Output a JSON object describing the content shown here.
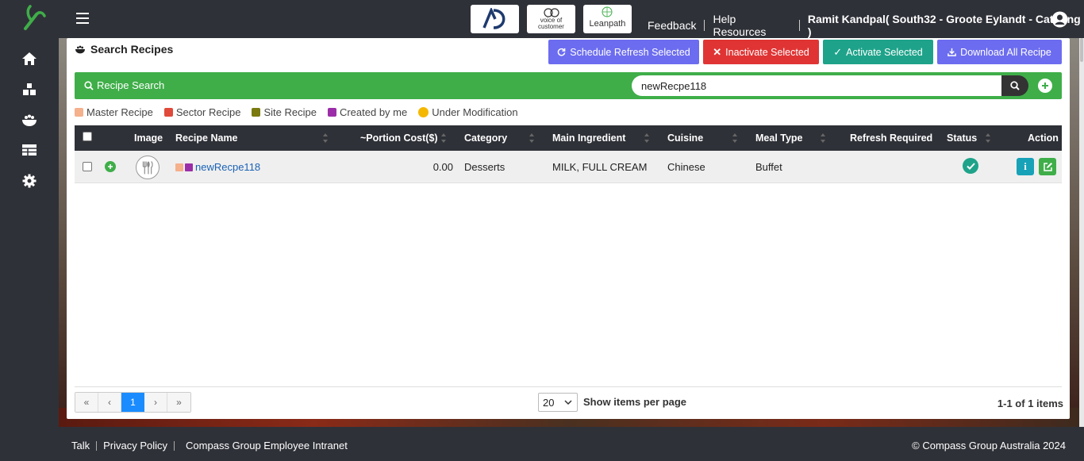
{
  "header": {
    "brands": [
      "AD",
      "voice of customer",
      "Leanpath"
    ],
    "links": [
      "Feedback",
      "Help Resources"
    ],
    "user": "Ramit Kandpal( South32 - Groote Eylandt - Catering )"
  },
  "sidebar": {
    "items": [
      "home-icon",
      "inventory-icon",
      "recipe-icon",
      "table-icon",
      "gear-icon"
    ]
  },
  "page": {
    "title": "Search Recipes",
    "buttons": {
      "refresh": "Schedule Refresh Selected",
      "inactivate": "Inactivate Selected",
      "activate": "Activate Selected",
      "download": "Download All Recipe"
    },
    "search": {
      "label": "Recipe Search",
      "value": "newRecpe118"
    },
    "legend": [
      {
        "label": "Master Recipe",
        "color": "#f5b08c"
      },
      {
        "label": "Sector Recipe",
        "color": "#e04a3a"
      },
      {
        "label": "Site Recipe",
        "color": "#7a7a10"
      },
      {
        "label": "Created by me",
        "color": "#9b2ea8"
      },
      {
        "label": "Under Modification",
        "color": "#f5b800"
      }
    ]
  },
  "table": {
    "columns": [
      "Image",
      "Recipe Name",
      "~Portion Cost($)",
      "Category",
      "Main Ingredient",
      "Cuisine",
      "Meal Type",
      "Refresh Required",
      "Status",
      "Action"
    ],
    "rows": [
      {
        "name": "newRecpe118",
        "portion_cost": "0.00",
        "category": "Desserts",
        "main_ingredient": "MILK, FULL CREAM",
        "cuisine": "Chinese",
        "meal_type": "Buffet",
        "refresh_required": "",
        "status": "active"
      }
    ]
  },
  "pagination": {
    "first": "«",
    "prev": "‹",
    "current": "1",
    "next": "›",
    "last": "»",
    "per_page": "20",
    "per_page_label": "Show items per page",
    "count": "1-1 of 1 items"
  },
  "footer": {
    "links": [
      "Talk",
      "Privacy Policy",
      "Compass Group Employee Intranet"
    ],
    "copyright": "© Compass Group Australia 2024"
  },
  "colors": {
    "primary_green": "#3fae49",
    "dark": "#2f3138",
    "link_blue": "#1a62b6"
  }
}
